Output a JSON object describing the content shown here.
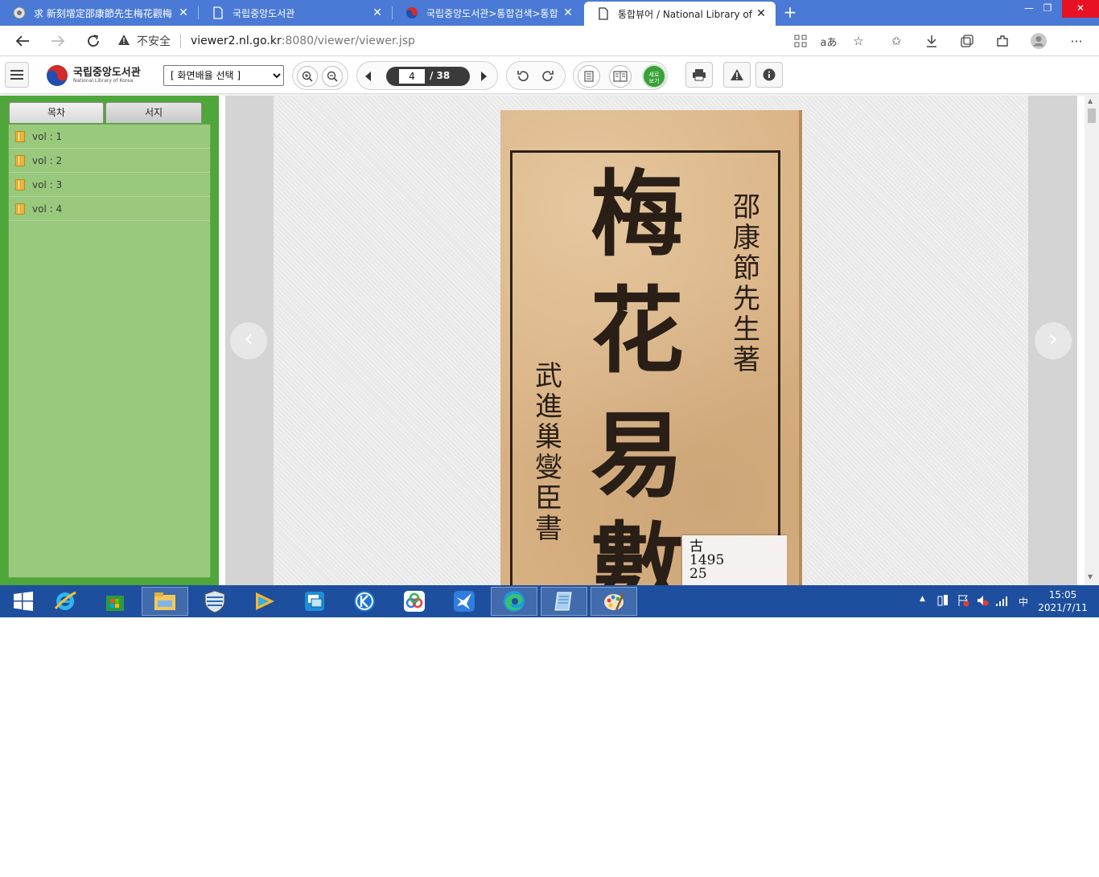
{
  "browser": {
    "tabs": [
      {
        "title": "求 新刻增定邵康節先生梅花觀梅",
        "active": false
      },
      {
        "title": "국립중앙도서관",
        "active": false
      },
      {
        "title": "국립중앙도서관>통합검색>통합",
        "active": false
      },
      {
        "title": "통합뷰어 / National Library of Ko",
        "active": true
      }
    ],
    "tab_close": "✕",
    "new_tab": "+",
    "address": {
      "security_label": "不安全",
      "host": "viewer2.nl.go.kr",
      "path": ":8080/viewer/viewer.jsp"
    }
  },
  "viewer": {
    "logo": {
      "korean": "국립중앙도서관",
      "english": "National Library of Korea"
    },
    "layout_select": {
      "selected": "[ 화면배율 선택 ]"
    },
    "page": {
      "current": "4",
      "total": "/ 38"
    },
    "vertical_view_label": "세로\n보기",
    "sidebar": {
      "tabs": [
        "목차",
        "서지"
      ],
      "items": [
        "vol : 1",
        "vol : 2",
        "vol : 3",
        "vol : 4"
      ]
    },
    "document": {
      "title_chars": [
        "梅",
        "花",
        "易",
        "數"
      ],
      "author": "邵康節先生著",
      "publisher": "武進巢燮臣書",
      "call_number": "古\n1495\n25"
    }
  },
  "taskbar": {
    "ime": "中",
    "time": "15:05",
    "date": "2021/7/11"
  },
  "colors": {
    "tabstrip": "#4a7ad6",
    "sidebar_green": "#4fa63a",
    "toc_green": "#98c97c",
    "page_paper": "#d8b183",
    "taskbar": "#1e4f9e"
  }
}
